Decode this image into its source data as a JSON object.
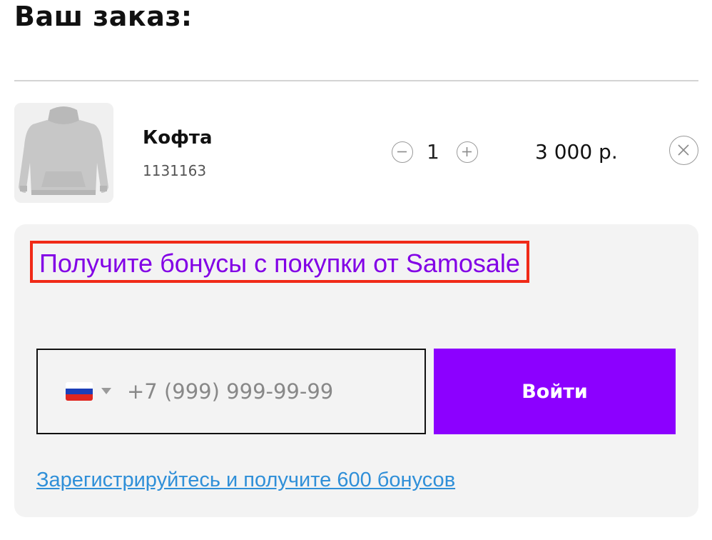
{
  "order": {
    "title": "Ваш заказ:"
  },
  "item": {
    "name": "Кофта",
    "sku": "1131163",
    "image_icon": "hoodie-image",
    "quantity": "1",
    "price": "3 000 р."
  },
  "bonus": {
    "heading": "Получите бонусы с покупки от Samosale",
    "country_flag": "russia-flag-icon",
    "phone_placeholder": "+7 (999) 999-99-99",
    "login_label": "Войти",
    "register_link": "Зарегистрируйтесь и получите 600 бонусов"
  },
  "colors": {
    "accent": "#8c00ff",
    "heading_text": "#8200e6",
    "highlight_border": "#f02a17",
    "link": "#2f8fd8",
    "panel_bg": "#f3f3f3"
  }
}
